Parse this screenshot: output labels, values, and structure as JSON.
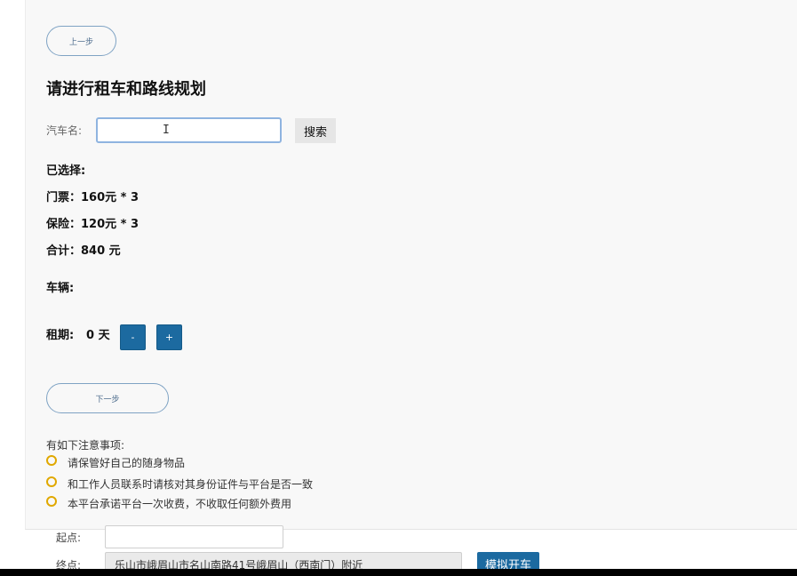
{
  "nav": {
    "prev_label": "上一步",
    "next_label": "下一步"
  },
  "page": {
    "title": "请进行租车和路线规划"
  },
  "search": {
    "label": "汽车名:",
    "value": "",
    "button_label": "搜索"
  },
  "summary": {
    "selected_title": "已选择:",
    "ticket": "门票：160元 * 3",
    "insurance": "保险：120元 * 3",
    "total": "合计：840 元",
    "vehicle": "车辆:"
  },
  "rental": {
    "label": "租期:",
    "days": "0 天",
    "minus_label": "-",
    "plus_label": "+"
  },
  "notices": {
    "title": "有如下注意事项:",
    "items": [
      "请保管好自己的随身物品",
      "和工作人员联系时请核对其身份证件与平台是否一致",
      "本平台承诺平台一次收费，不收取任何额外费用"
    ],
    "bullet_color": "#e0a800"
  },
  "route": {
    "start_label": "起点:",
    "start_value": "",
    "end_label": "终点:",
    "end_value": "乐山市峨眉山市名山南路41号峨眉山（西南门）附近",
    "drive_button": "模拟开车"
  },
  "colors": {
    "accent": "#1c6aa0",
    "pill_border": "#7fa3c4"
  }
}
